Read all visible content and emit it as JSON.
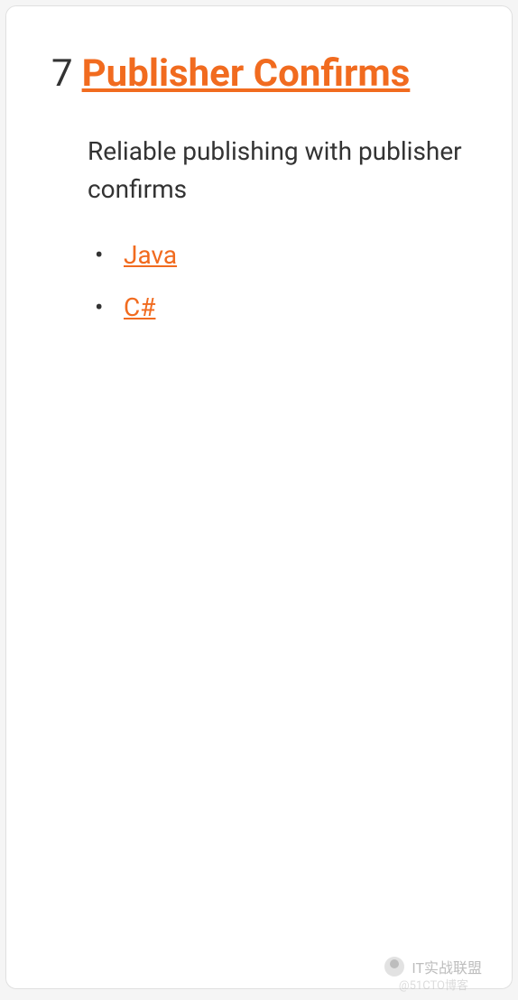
{
  "section": {
    "number": "7",
    "title": "Publisher Confirms",
    "description": "Reliable publishing with publisher confirms",
    "links": [
      {
        "label": "Java"
      },
      {
        "label": "C#"
      }
    ]
  },
  "watermark": {
    "text": "IT实战联盟",
    "sub": "@51CTO博客"
  }
}
